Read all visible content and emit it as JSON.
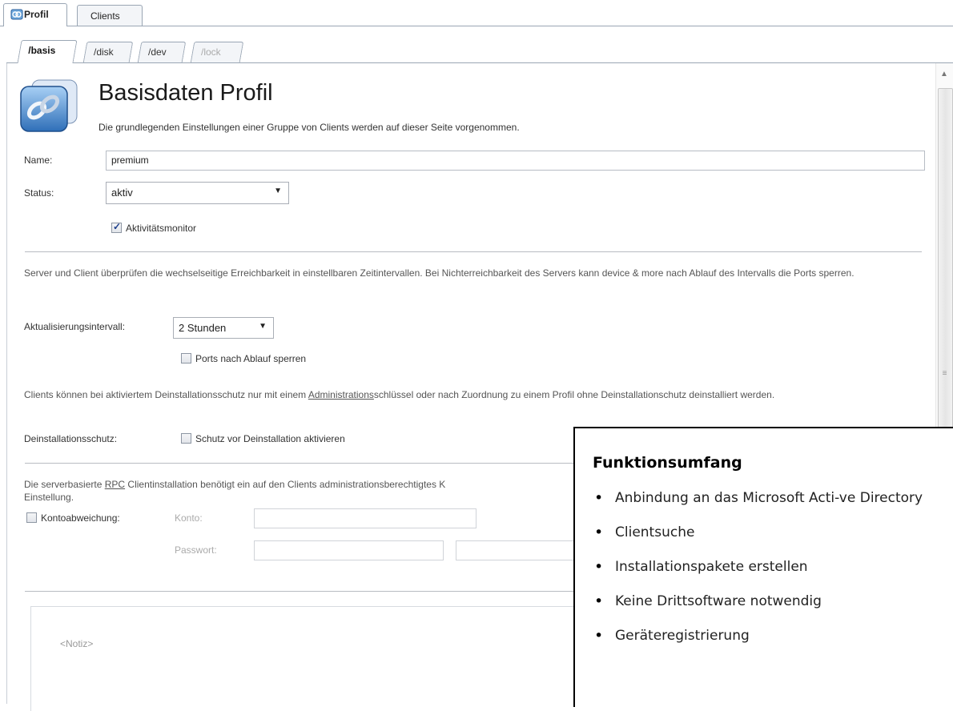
{
  "top_tabs": [
    {
      "label": "Profil",
      "active": true
    },
    {
      "label": "Clients",
      "active": false
    }
  ],
  "sub_tabs": [
    {
      "label": "/basis",
      "active": true
    },
    {
      "label": "/disk"
    },
    {
      "label": "/dev"
    },
    {
      "label": "/lock",
      "disabled": true
    }
  ],
  "header": {
    "title": "Basisdaten Profil",
    "subtitle": "Die grundlegenden Einstellungen einer Gruppe von Clients werden auf dieser Seite vorgenommen."
  },
  "name": {
    "label": "Name:",
    "value": "premium"
  },
  "status": {
    "label": "Status:",
    "value": "aktiv"
  },
  "activity_monitor": {
    "label": "Aktivitätsmonitor",
    "checked": true
  },
  "server_section": {
    "text": "Server und Client überprüfen die wechselseitige Erreichbarkeit in einstellbaren Zeitintervallen. Bei Nichterreichbarkeit des Servers kann device & more nach Ablauf des Intervalls die Ports sperren.",
    "interval_label": "Aktualisierungsintervall:",
    "interval_value": "2 Stunden",
    "lock_ports_label": "Ports nach Ablauf sperren"
  },
  "uninstall_section": {
    "text_pre": "Clients können bei aktiviertem Deinstallationsschutz nur mit einem ",
    "text_link": "Administrations",
    "text_post": "schlüssel oder nach Zuordnung zu einem Profil ohne Deinstallationschutz deinstalliert werden.",
    "label": "Deinstallationsschutz:",
    "checkbox_label": "Schutz vor Deinstallation aktivieren"
  },
  "rpc_section": {
    "text_pre": "Die serverbasierte ",
    "text_link": "RPC",
    "text_post": " Clientinstallation benötigt ein auf den Clients administrationsberechtigtes K",
    "text_line2": "Einstellung.",
    "account_deviation_label": "Kontoabweichung:",
    "account_label": "Konto:",
    "password_label": "Passwort:"
  },
  "note_placeholder": "<Notiz>",
  "overlay": {
    "title": "Funktionsumfang",
    "items": [
      "Anbindung an das Microsoft Acti-ve Directory",
      "Clientsuche",
      "Installationspakete erstellen",
      "Keine Drittsoftware notwendig",
      "Geräteregistrierung"
    ]
  }
}
